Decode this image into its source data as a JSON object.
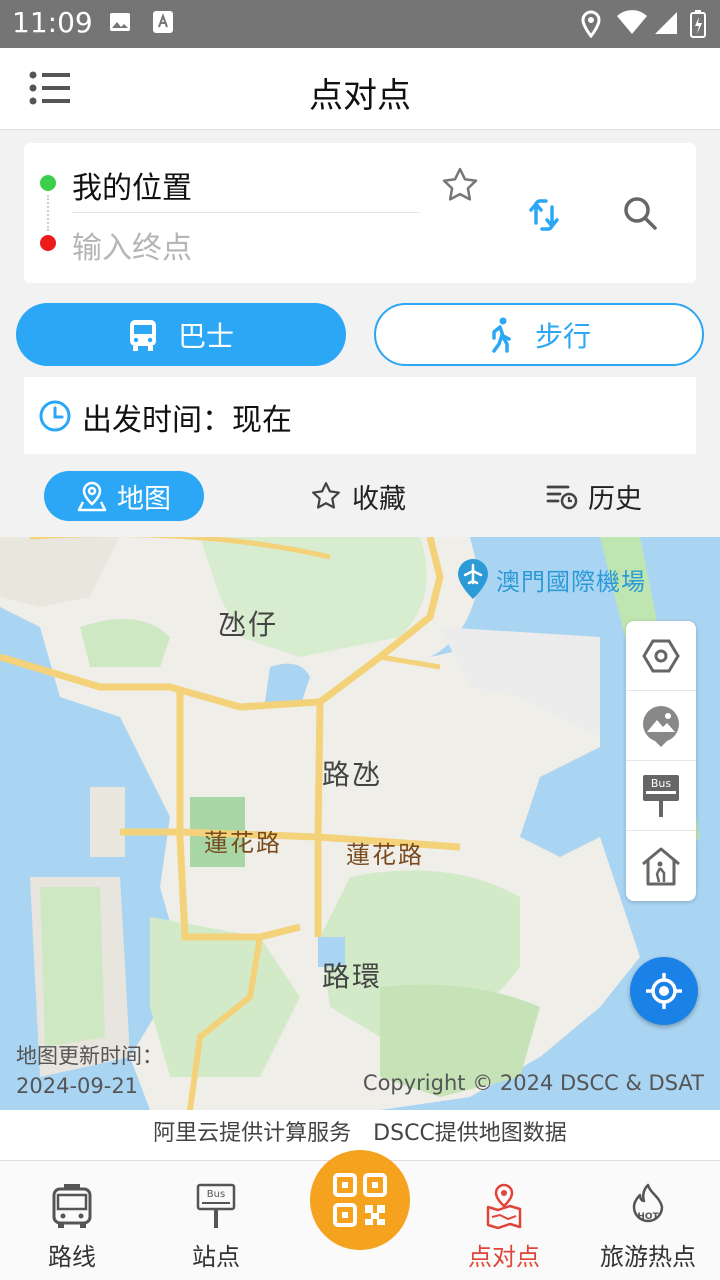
{
  "status_bar": {
    "time": "11:09"
  },
  "header": {
    "title": "点对点"
  },
  "route": {
    "start": "我的位置",
    "end_placeholder": "输入终点"
  },
  "modes": {
    "bus": "巴士",
    "walk": "步行"
  },
  "departure": {
    "label": "出发时间：现在"
  },
  "tabs": [
    {
      "label": "地图"
    },
    {
      "label": "收藏"
    },
    {
      "label": "历史"
    }
  ],
  "map": {
    "labels": {
      "taipa": "氹仔",
      "cotai": "路氹",
      "lotus_road_1": "蓮花路",
      "lotus_road_2": "蓮花路",
      "coloane": "路環"
    },
    "airport": "澳門國際機場",
    "update_label": "地图更新时间：",
    "update_date": "2024-09-21",
    "copyright": "Copyright © 2024 DSCC & DSAT",
    "bus_sign": "Bus"
  },
  "provider": "阿里云提供计算服务　DSCC提供地图数据",
  "bottom_nav": [
    {
      "label": "路线",
      "icon": "bus-front-icon"
    },
    {
      "label": "站点",
      "icon": "bus-stop-icon"
    },
    {
      "label": "点对点",
      "icon": "map-pin-route-icon"
    },
    {
      "label": "旅游热点",
      "icon": "hot-fire-icon"
    }
  ],
  "colors": {
    "accent": "#2ba7f5",
    "active_nav": "#e0453a",
    "qr": "#f5a21f",
    "locate": "#1a82e6"
  }
}
